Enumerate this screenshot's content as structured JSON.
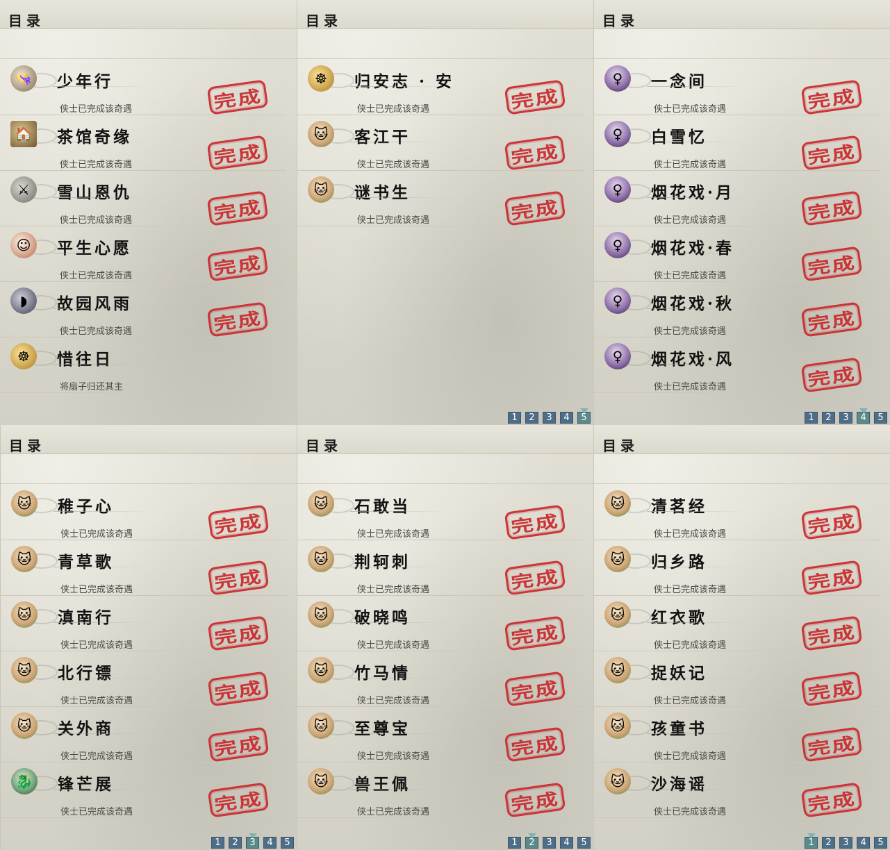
{
  "panels": [
    {
      "title": "目录",
      "entries": [
        {
          "name": "少年行",
          "status": "侠士已完成该奇遇",
          "icon": "straw-hat-man-icon",
          "done": true
        },
        {
          "name": "茶馆奇缘",
          "status": "侠士已完成该奇遇",
          "icon": "teahouse-icon",
          "done": true
        },
        {
          "name": "雪山恩仇",
          "status": "侠士已完成该奇遇",
          "icon": "sword-icon",
          "done": true
        },
        {
          "name": "平生心愿",
          "status": "侠士已完成该奇遇",
          "icon": "child-scholar-icon",
          "done": true
        },
        {
          "name": "故园风雨",
          "status": "侠士已完成该奇遇",
          "icon": "fan-icon",
          "done": true
        },
        {
          "name": "惜往日",
          "status": "将扇子归还其主",
          "icon": "golden-buddha-icon",
          "done": false
        }
      ],
      "pager": []
    },
    {
      "title": "目录",
      "entries": [
        {
          "name": "归安志 · 安",
          "status": "侠士已完成该奇遇",
          "icon": "golden-buddha-icon",
          "done": true
        },
        {
          "name": "客江干",
          "status": "侠士已完成该奇遇",
          "icon": "lucky-cat-icon",
          "done": true
        },
        {
          "name": "谜书生",
          "status": "侠士已完成该奇遇",
          "icon": "lucky-cat-icon",
          "done": true
        }
      ],
      "pager": [
        "1",
        "2",
        "3",
        "4",
        "5"
      ],
      "active_page": "5"
    },
    {
      "title": "目录",
      "entries": [
        {
          "name": "一念间",
          "status": "侠士已完成该奇遇",
          "icon": "lady-portrait-icon",
          "done": true
        },
        {
          "name": "白雪忆",
          "status": "侠士已完成该奇遇",
          "icon": "lady-portrait-icon",
          "done": true
        },
        {
          "name": "烟花戏·月",
          "status": "侠士已完成该奇遇",
          "icon": "lady-portrait-icon",
          "done": true
        },
        {
          "name": "烟花戏·春",
          "status": "侠士已完成该奇遇",
          "icon": "lady-portrait-icon",
          "done": true
        },
        {
          "name": "烟花戏·秋",
          "status": "侠士已完成该奇遇",
          "icon": "lady-portrait-icon",
          "done": true
        },
        {
          "name": "烟花戏·风",
          "status": "侠士已完成该奇遇",
          "icon": "lady-portrait-icon",
          "done": true
        }
      ],
      "pager": [
        "1",
        "2",
        "3",
        "4",
        "5"
      ],
      "active_page": "4"
    },
    {
      "title": "目录",
      "entries": [
        {
          "name": "稚子心",
          "status": "侠士已完成该奇遇",
          "icon": "lucky-cat-icon",
          "done": true
        },
        {
          "name": "青草歌",
          "status": "侠士已完成该奇遇",
          "icon": "lucky-cat-icon",
          "done": true
        },
        {
          "name": "滇南行",
          "status": "侠士已完成该奇遇",
          "icon": "lucky-cat-icon",
          "done": true
        },
        {
          "name": "北行镖",
          "status": "侠士已完成该奇遇",
          "icon": "lucky-cat-icon",
          "done": true
        },
        {
          "name": "关外商",
          "status": "侠士已完成该奇遇",
          "icon": "lucky-cat-icon",
          "done": true
        },
        {
          "name": "锋芒展",
          "status": "侠士已完成该奇遇",
          "icon": "jade-dragon-icon",
          "done": true
        }
      ],
      "pager": [
        "1",
        "2",
        "3",
        "4",
        "5"
      ],
      "active_page": "3"
    },
    {
      "title": "目录",
      "entries": [
        {
          "name": "石敢当",
          "status": "侠士已完成该奇遇",
          "icon": "lucky-cat-icon",
          "done": true
        },
        {
          "name": "荆轲刺",
          "status": "侠士已完成该奇遇",
          "icon": "lucky-cat-icon",
          "done": true
        },
        {
          "name": "破晓鸣",
          "status": "侠士已完成该奇遇",
          "icon": "lucky-cat-icon",
          "done": true
        },
        {
          "name": "竹马情",
          "status": "侠士已完成该奇遇",
          "icon": "lucky-cat-icon",
          "done": true
        },
        {
          "name": "至尊宝",
          "status": "侠士已完成该奇遇",
          "icon": "lucky-cat-icon",
          "done": true
        },
        {
          "name": "兽王佩",
          "status": "侠士已完成该奇遇",
          "icon": "lucky-cat-icon",
          "done": true
        }
      ],
      "pager": [
        "1",
        "2",
        "3",
        "4",
        "5"
      ],
      "active_page": "2"
    },
    {
      "title": "目录",
      "entries": [
        {
          "name": "清茗经",
          "status": "侠士已完成该奇遇",
          "icon": "lucky-cat-icon",
          "done": true
        },
        {
          "name": "归乡路",
          "status": "侠士已完成该奇遇",
          "icon": "lucky-cat-icon",
          "done": true
        },
        {
          "name": "红衣歌",
          "status": "侠士已完成该奇遇",
          "icon": "lucky-cat-icon",
          "done": true
        },
        {
          "name": "捉妖记",
          "status": "侠士已完成该奇遇",
          "icon": "lucky-cat-icon",
          "done": true
        },
        {
          "name": "孩童书",
          "status": "侠士已完成该奇遇",
          "icon": "lucky-cat-icon",
          "done": true
        },
        {
          "name": "沙海谣",
          "status": "侠士已完成该奇遇",
          "icon": "lucky-cat-icon",
          "done": true
        }
      ],
      "pager": [
        "1",
        "2",
        "3",
        "4",
        "5"
      ],
      "active_page": "1"
    }
  ],
  "stamp_text": "完成",
  "colors": {
    "stamp": "#c9282c",
    "pager_button": "#4e6d86",
    "pager_active": "#5a8a8a",
    "panel_bg": "#dcdacd"
  }
}
